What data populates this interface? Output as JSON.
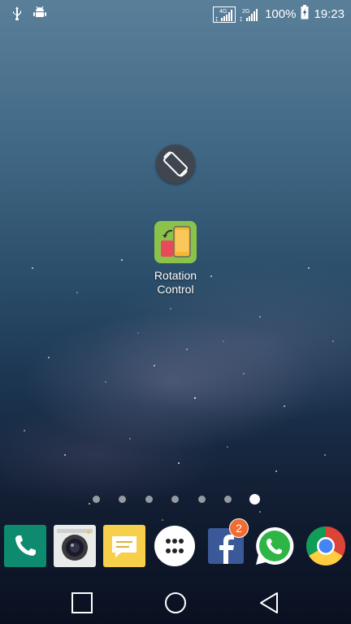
{
  "status_bar": {
    "left_icons": [
      "usb-icon",
      "android-debug-icon"
    ],
    "signal1_label": "4G",
    "signal2_label": "2G",
    "battery_percent": "100%",
    "time": "19:23"
  },
  "home": {
    "center_widget_icon": "screen-rotation-icon",
    "app": {
      "label_line1": "Rotation",
      "label_line2": "Control"
    },
    "page_indicator": {
      "count": 7,
      "active_index": 6
    }
  },
  "dock": {
    "apps": [
      {
        "name": "phone",
        "icon": "phone-icon"
      },
      {
        "name": "camera",
        "icon": "camera-icon"
      },
      {
        "name": "messages",
        "icon": "message-icon"
      },
      {
        "name": "apps",
        "icon": "apps-grid-icon"
      },
      {
        "name": "facebook",
        "icon": "facebook-icon",
        "badge": "2"
      },
      {
        "name": "whatsapp",
        "icon": "whatsapp-icon"
      },
      {
        "name": "chrome",
        "icon": "chrome-icon"
      }
    ]
  },
  "nav_bar": {
    "buttons": [
      "recent-apps-icon",
      "home-icon",
      "back-icon"
    ]
  },
  "colors": {
    "accent_green": "#8bc34a",
    "badge_orange": "#f26b30",
    "phone_teal": "#0e8a6f"
  }
}
